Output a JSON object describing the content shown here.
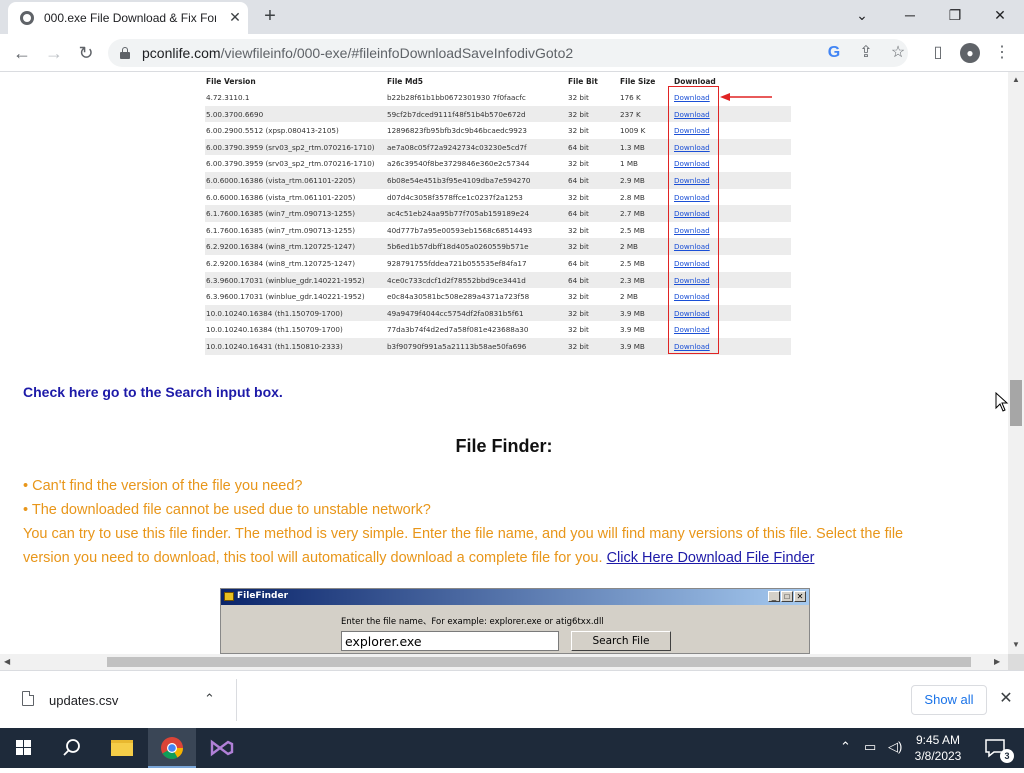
{
  "browser": {
    "tab_title": "000.exe File Download & Fix For",
    "url_host": "pconlife.com",
    "url_path": "/viewfileinfo/000-exe/#fileinfoDownloadSaveInfodivGoto2"
  },
  "table": {
    "headers": [
      "File Version",
      "File Md5",
      "File Bit",
      "File Size",
      "Download"
    ],
    "rows": [
      [
        "4.72.3110.1",
        "b22b28f61b1bb0672301930 7f0faacfc",
        "32 bit",
        "176 K",
        "Download"
      ],
      [
        "5.00.3700.6690",
        "59cf2b7dced9111f48f51b4b570e672d",
        "32 bit",
        "237 K",
        "Download"
      ],
      [
        "6.00.2900.5512 (xpsp.080413-2105)",
        "12896823fb95bfb3dc9b46bcaedc9923",
        "32 bit",
        "1009 K",
        "Download"
      ],
      [
        "6.00.3790.3959 (srv03_sp2_rtm.070216-1710)",
        "ae7a08c05f72a9242734c03230e5cd7f",
        "64 bit",
        "1.3 MB",
        "Download"
      ],
      [
        "6.00.3790.3959 (srv03_sp2_rtm.070216-1710)",
        "a26c39540f8be3729846e360e2c57344",
        "32 bit",
        "1 MB",
        "Download"
      ],
      [
        "6.0.6000.16386 (vista_rtm.061101-2205)",
        "6b08e54e451b3f95e4109dba7e594270",
        "64 bit",
        "2.9 MB",
        "Download"
      ],
      [
        "6.0.6000.16386 (vista_rtm.061101-2205)",
        "d07d4c3058f3578ffce1c0237f2a1253",
        "32 bit",
        "2.8 MB",
        "Download"
      ],
      [
        "6.1.7600.16385 (win7_rtm.090713-1255)",
        "ac4c51eb24aa95b77f705ab159189e24",
        "64 bit",
        "2.7 MB",
        "Download"
      ],
      [
        "6.1.7600.16385 (win7_rtm.090713-1255)",
        "40d777b7a95e00593eb1568c68514493",
        "32 bit",
        "2.5 MB",
        "Download"
      ],
      [
        "6.2.9200.16384 (win8_rtm.120725-1247)",
        "5b6ed1b57dbff18d405a0260559b571e",
        "32 bit",
        "2 MB",
        "Download"
      ],
      [
        "6.2.9200.16384 (win8_rtm.120725-1247)",
        "928791755fddea721b055535ef84fa17",
        "64 bit",
        "2.5 MB",
        "Download"
      ],
      [
        "6.3.9600.17031 (winblue_gdr.140221-1952)",
        "4ce0c733cdcf1d2f78552bbd9ce3441d",
        "64 bit",
        "2.3 MB",
        "Download"
      ],
      [
        "6.3.9600.17031 (winblue_gdr.140221-1952)",
        "e0c84a30581bc508e289a4371a723f58",
        "32 bit",
        "2 MB",
        "Download"
      ],
      [
        "10.0.10240.16384 (th1.150709-1700)",
        "49a9479f4044cc5754df2fa0831b5f61",
        "32 bit",
        "3.9 MB",
        "Download"
      ],
      [
        "10.0.10240.16384 (th1.150709-1700)",
        "77da3b74f4d2ed7a58f081e423688a30",
        "32 bit",
        "3.9 MB",
        "Download"
      ],
      [
        "10.0.10240.16431 (th1.150810-2333)",
        "b3f90790f991a5a21113b58ae50fa696",
        "32 bit",
        "3.9 MB",
        "Download"
      ]
    ]
  },
  "content": {
    "search_link": "Check here go to the Search input box.",
    "finder_heading": "File Finder:",
    "bullet1": "• Can't find the version of the file you need?",
    "bullet2": "• The downloaded file cannot be used due to unstable network?",
    "para_line1": "You can try to use this file finder. The method is very simple. Enter the file name, and you will find many versions of this file. Select the file",
    "para_line2": "version you need to download, this tool will automatically download a complete file for you. ",
    "finder_link": "Click Here Download File Finder"
  },
  "file_finder": {
    "title": "FileFinder",
    "label": "Enter the file name、For example: explorer.exe or atig6txx.dll",
    "input_value": "explorer.exe",
    "search_button": "Search File"
  },
  "download_bar": {
    "file_name": "updates.csv",
    "show_all": "Show all"
  },
  "taskbar": {
    "time": "9:45 AM",
    "date": "3/8/2023",
    "notification_count": "3"
  }
}
